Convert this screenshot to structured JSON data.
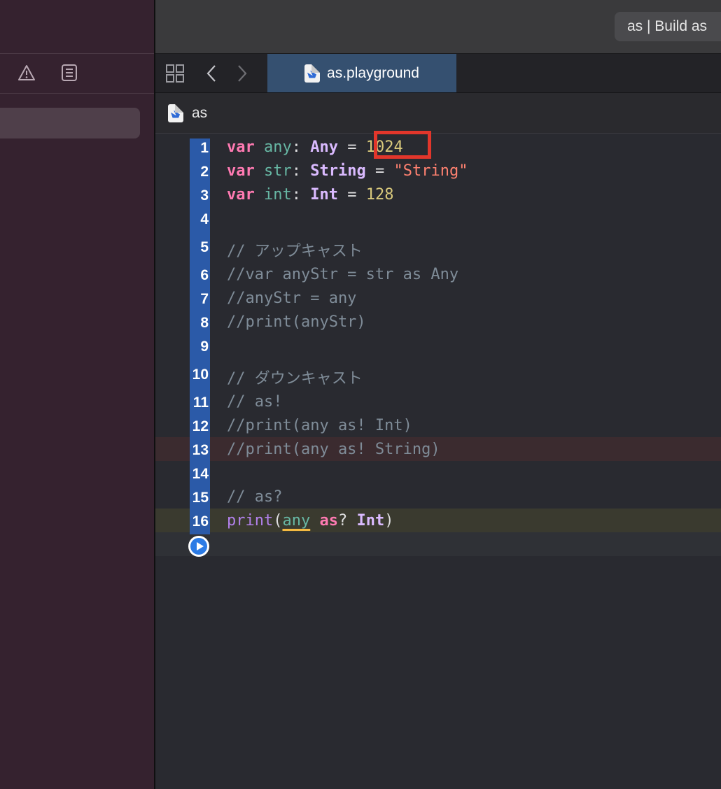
{
  "toolbar": {
    "activity_text": "as | Build as "
  },
  "sidebar": {
    "icons": [
      "warning-icon",
      "issue-list-icon"
    ]
  },
  "tabbar": {
    "grid_icon": "grid-icon",
    "back_icon": "chevron-left-icon",
    "forward_icon": "chevron-right-icon",
    "tab_label": "as.playground"
  },
  "jumpbar": {
    "file_label": "as"
  },
  "editor": {
    "line_numbers": [
      "1",
      "2",
      "3",
      "4",
      "5",
      "6",
      "7",
      "8",
      "9",
      "10",
      "11",
      "12",
      "13",
      "14",
      "15",
      "16"
    ],
    "lines": {
      "l1": [
        "var",
        "any",
        ": ",
        "Any",
        " = ",
        "1024"
      ],
      "l2": [
        "var",
        "str",
        ": ",
        "String",
        " = ",
        "\"String\""
      ],
      "l3": [
        "var",
        "int",
        ": ",
        "Int",
        " = ",
        "128"
      ],
      "l5": "// アップキャスト",
      "l6": "//var anyStr = str as Any",
      "l7": "//anyStr = any",
      "l8": "//print(anyStr)",
      "l10": "// ダウンキャスト",
      "l11": "// as!",
      "l12": "//print(any as! Int)",
      "l13": "//print(any as! String)",
      "l15": "// as?",
      "l16": [
        "print",
        "(",
        "any",
        " ",
        "as",
        "? ",
        "Int",
        ")"
      ]
    },
    "colors": {
      "keyword": "#ff7ab2",
      "type": "#dabaff",
      "number": "#d9c97c",
      "string": "#ff8170",
      "comment": "#7f8c98",
      "gutter": "#2b5aa8",
      "highlight_box": "#e2362b"
    },
    "run_icon": "run-play-icon"
  }
}
